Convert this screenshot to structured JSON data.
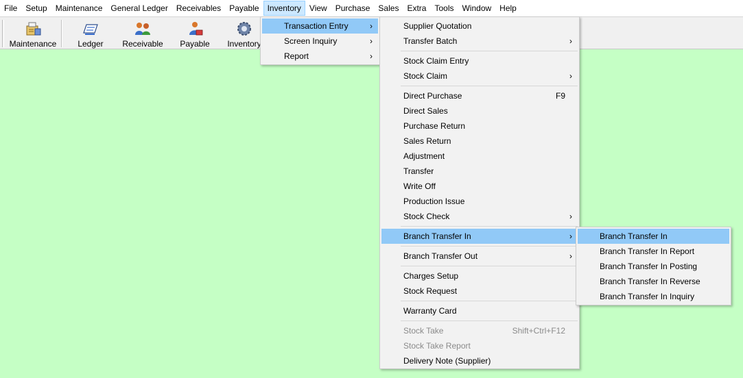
{
  "menubar": {
    "items": [
      {
        "label": "File"
      },
      {
        "label": "Setup"
      },
      {
        "label": "Maintenance"
      },
      {
        "label": "General Ledger"
      },
      {
        "label": "Receivables"
      },
      {
        "label": "Payable"
      },
      {
        "label": "Inventory",
        "active": true
      },
      {
        "label": "View"
      },
      {
        "label": "Purchase"
      },
      {
        "label": "Sales"
      },
      {
        "label": "Extra"
      },
      {
        "label": "Tools"
      },
      {
        "label": "Window"
      },
      {
        "label": "Help"
      }
    ]
  },
  "toolbar": {
    "buttons": [
      {
        "label": "Maintenance",
        "icon": "maintenance-icon"
      },
      {
        "label": "Ledger",
        "icon": "ledger-icon"
      },
      {
        "label": "Receivable",
        "icon": "receivable-icon"
      },
      {
        "label": "Payable",
        "icon": "payable-icon"
      },
      {
        "label": "Inventory",
        "icon": "inventory-gear-icon"
      }
    ]
  },
  "inventory_menu": {
    "items": [
      {
        "label": "Transaction Entry",
        "arrow": "›",
        "highlighted": true
      },
      {
        "label": "Screen Inquiry",
        "arrow": "›"
      },
      {
        "label": "Report",
        "arrow": "›"
      }
    ]
  },
  "transaction_entry_menu": {
    "items": [
      {
        "label": "Supplier Quotation"
      },
      {
        "label": "Transfer Batch",
        "arrow": "›"
      },
      {
        "label": "Stock Claim Entry"
      },
      {
        "label": "Stock Claim",
        "arrow": "›"
      },
      {
        "label": "Direct Purchase",
        "shortcut": "F9"
      },
      {
        "label": "Direct Sales"
      },
      {
        "label": "Purchase Return"
      },
      {
        "label": "Sales Return"
      },
      {
        "label": "Adjustment"
      },
      {
        "label": "Transfer"
      },
      {
        "label": "Write Off"
      },
      {
        "label": "Production Issue"
      },
      {
        "label": "Stock Check",
        "arrow": "›"
      },
      {
        "label": "Branch Transfer In",
        "arrow": "›",
        "highlighted": true
      },
      {
        "label": "Branch Transfer Out",
        "arrow": "›"
      },
      {
        "label": "Charges Setup"
      },
      {
        "label": "Stock Request"
      },
      {
        "label": "Warranty Card"
      },
      {
        "label": "Stock Take",
        "shortcut": "Shift+Ctrl+F12",
        "disabled": true
      },
      {
        "label": "Stock Take Report",
        "disabled": true
      },
      {
        "label": "Delivery Note (Supplier)"
      }
    ]
  },
  "branch_transfer_in_menu": {
    "items": [
      {
        "label": "Branch Transfer In",
        "highlighted": true
      },
      {
        "label": "Branch Transfer In Report"
      },
      {
        "label": "Branch Transfer In Posting"
      },
      {
        "label": "Branch Transfer In Reverse"
      },
      {
        "label": "Branch Transfer In Inquiry"
      }
    ]
  },
  "colors": {
    "desktop_bg": "#c5ffc5",
    "menu_highlight": "#91c9f7",
    "menubar_active": "#cce8ff"
  }
}
